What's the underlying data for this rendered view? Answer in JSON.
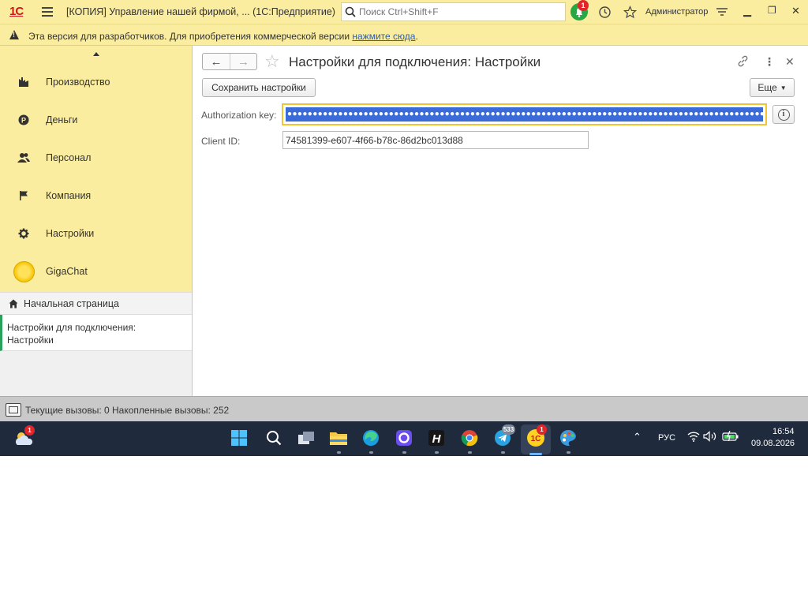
{
  "titlebar": {
    "logo": "1С",
    "window_title": "[КОПИЯ] Управление нашей фирмой, ...  (1С:Предприятие)",
    "search_placeholder": "Поиск Ctrl+Shift+F",
    "notifications_count": "1",
    "user": "Администратор"
  },
  "warning": {
    "text": "Эта версия для разработчиков. Для приобретения коммерческой версии ",
    "link": "нажмите сюда",
    "tail": "."
  },
  "sidebar": {
    "items": [
      {
        "label": "Производство",
        "icon": "factory-icon"
      },
      {
        "label": "Деньги",
        "icon": "ruble-icon"
      },
      {
        "label": "Персонал",
        "icon": "people-icon"
      },
      {
        "label": "Компания",
        "icon": "flag-icon"
      },
      {
        "label": "Настройки",
        "icon": "gear-icon"
      },
      {
        "label": "GigaChat",
        "icon": "gigachat-icon"
      }
    ],
    "home": "Начальная страница",
    "open_window": "Настройки для подключения: Настройки"
  },
  "form": {
    "title": "Настройки для подключения: Настройки",
    "save_button": "Сохранить настройки",
    "more_button": "Еще",
    "auth_label": "Authorization key:",
    "auth_value": "●●●●●●●●●●●●●●●●●●●●●●●●●●●●●●●●●●●●●●●●●●●●●●●●●●●●●●●●●●●●●●●●●●●●●●●●●●●●●●●●●●●●●●●●●●●●●●●●●●",
    "client_label": "Client ID:",
    "client_value": "74581399-e607-4f66-b78c-86d2bc013d88"
  },
  "status": {
    "text": "Текущие вызовы: 0   Накопленные вызовы: 252"
  },
  "taskbar": {
    "weather_badge": "1",
    "telegram_badge": "533",
    "onec_badge": "1",
    "lang": "РУС",
    "time": "16:54",
    "date": "09.08.2026"
  },
  "colors": {
    "panel_yellow": "#fbeda0",
    "focus_border": "#f1c532",
    "selection_blue": "#3a6bd8",
    "taskbar": "#1f2a3c"
  }
}
